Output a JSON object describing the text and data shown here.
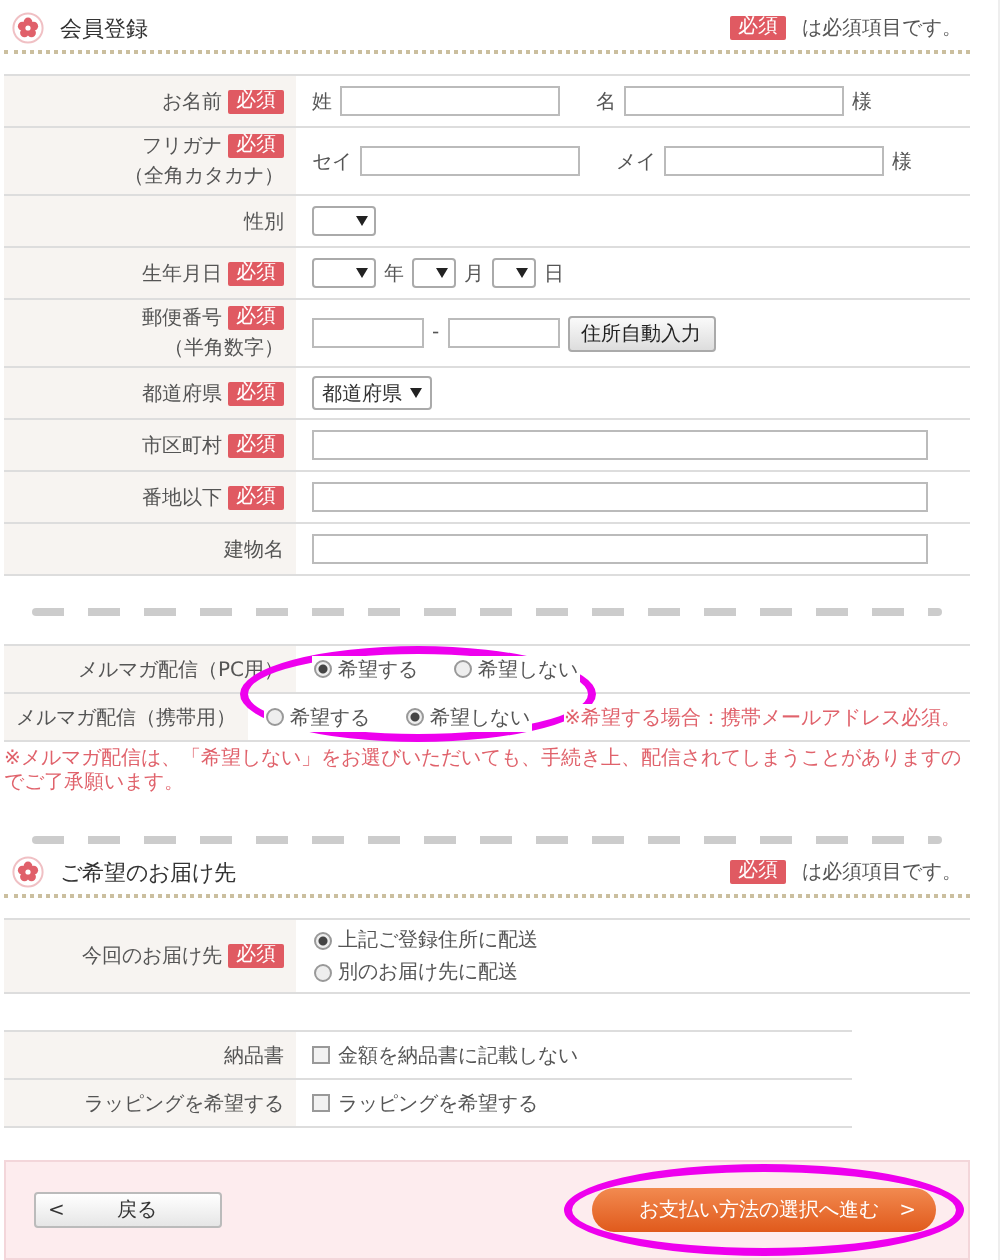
{
  "member": {
    "title": "会員登録",
    "note_badge": "必須",
    "note": "は必須項目です。",
    "rows": [
      {
        "kind": "name-pair",
        "label": "お名前",
        "badge": "必須",
        "fields": [
          {
            "prefix": "姓"
          },
          {
            "prefix": "名",
            "suffix": "様"
          }
        ]
      },
      {
        "kind": "name-pair",
        "label": "フリガナ",
        "sublabel": "（全角カタカナ）",
        "badge": "必須",
        "fields": [
          {
            "prefix": "セイ"
          },
          {
            "prefix": "メイ",
            "suffix": "様"
          }
        ]
      },
      {
        "kind": "selects",
        "label": "性別",
        "selects": [
          {
            "kind": "blank"
          }
        ]
      },
      {
        "kind": "selects",
        "label": "生年月日",
        "badge": "必須",
        "selects": [
          {
            "kind": "blank",
            "suffix": "年"
          },
          {
            "kind": "blank",
            "suffix": "月"
          },
          {
            "kind": "blank",
            "suffix": "日"
          }
        ]
      },
      {
        "kind": "postal",
        "label": "郵便番号",
        "sublabel": "（半角数字）",
        "badge": "必須",
        "separator": "-",
        "button": "住所自動入力"
      },
      {
        "kind": "prefecture",
        "label": "都道府県",
        "badge": "必須",
        "value": "都道府県"
      },
      {
        "kind": "text",
        "label": "市区町村",
        "badge": "必須"
      },
      {
        "kind": "text",
        "label": "番地以下",
        "badge": "必須"
      },
      {
        "kind": "text",
        "label": "建物名"
      }
    ]
  },
  "mail": {
    "highlighted": true,
    "rows": [
      {
        "label": "メルマガ配信（PC用）",
        "options": [
          {
            "label": "希望する",
            "selected": true
          },
          {
            "label": "希望しない",
            "selected": false
          }
        ]
      },
      {
        "label": "メルマガ配信（携帯用）",
        "options": [
          {
            "label": "希望する",
            "selected": false
          },
          {
            "label": "希望しない",
            "selected": true
          }
        ],
        "note": "※希望する場合：携帯メールアドレス必須。"
      }
    ],
    "footnote": "※メルマガ配信は、「希望しない」をお選びいただいても、手続き上、配信されてしまうことがありますのでご了承願います。"
  },
  "delivery": {
    "title": "ご希望のお届け先",
    "note_badge": "必須",
    "note": "は必須項目です。",
    "label": "今回のお届け先",
    "badge": "必須",
    "options": [
      {
        "label": "上記ご登録住所に配送",
        "selected": true
      },
      {
        "label": "別のお届け先に配送",
        "selected": false
      }
    ]
  },
  "extras": [
    {
      "label": "納品書",
      "checkbox": "金額を納品書に記載しない",
      "checked": false
    },
    {
      "label": "ラッピングを希望する",
      "checkbox": "ラッピングを希望する",
      "checked": false
    }
  ],
  "footer": {
    "back": {
      "arrow": "<",
      "label": "戻る"
    },
    "next": {
      "label": "お支払い方法の選択へ進む",
      "arrow": ">",
      "highlighted": true
    }
  }
}
